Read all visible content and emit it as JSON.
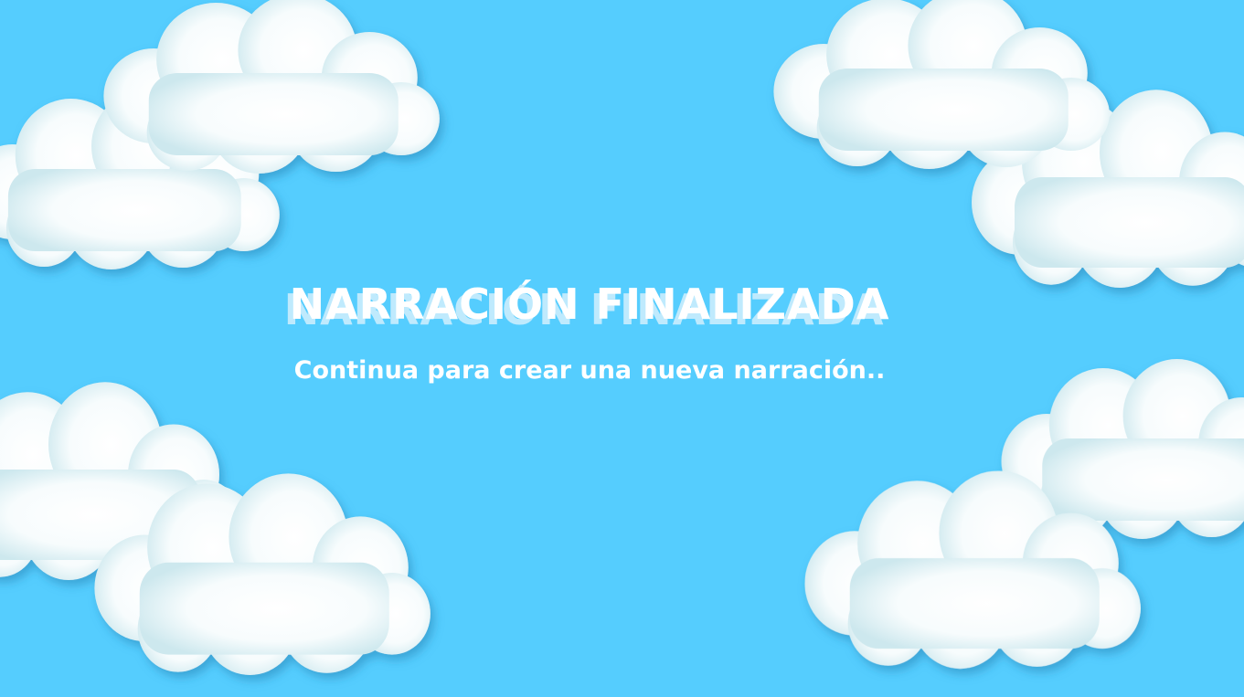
{
  "screen": {
    "title": "NARRACIÓN FINALIZADA",
    "subtitle": "Continua para crear una nueva narración.."
  },
  "colors": {
    "sky": "#55cdfe",
    "cloud": "#ffffff",
    "cloud_edge": "#cde8ee",
    "title_shadow": "#bfeafd"
  }
}
